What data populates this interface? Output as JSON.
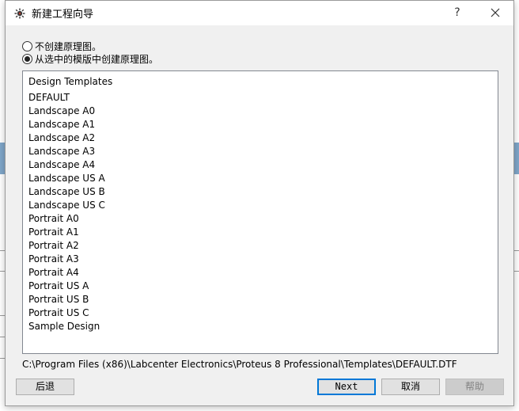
{
  "window": {
    "title": "新建工程向导",
    "help_glyph": "?",
    "close_icon": "close-icon",
    "app_icon": "proteus-icon"
  },
  "options": [
    {
      "label": "不创建原理图。",
      "checked": false
    },
    {
      "label": "从选中的模版中创建原理图。",
      "checked": true
    }
  ],
  "templates": {
    "header": "Design Templates",
    "items": [
      "DEFAULT",
      "Landscape A0",
      "Landscape A1",
      "Landscape A2",
      "Landscape A3",
      "Landscape A4",
      "Landscape US A",
      "Landscape US B",
      "Landscape US C",
      "Portrait A0",
      "Portrait A1",
      "Portrait A2",
      "Portrait A3",
      "Portrait A4",
      "Portrait US A",
      "Portrait US B",
      "Portrait US C",
      "Sample Design"
    ]
  },
  "selected_path": "C:\\Program Files (x86)\\Labcenter Electronics\\Proteus 8 Professional\\Templates\\DEFAULT.DTF",
  "buttons": {
    "back": "后退",
    "next": "Next",
    "cancel": "取消",
    "help": "帮助"
  },
  "colors": {
    "accent": "#0078d7",
    "dialog_bg": "#f0f0f0"
  }
}
